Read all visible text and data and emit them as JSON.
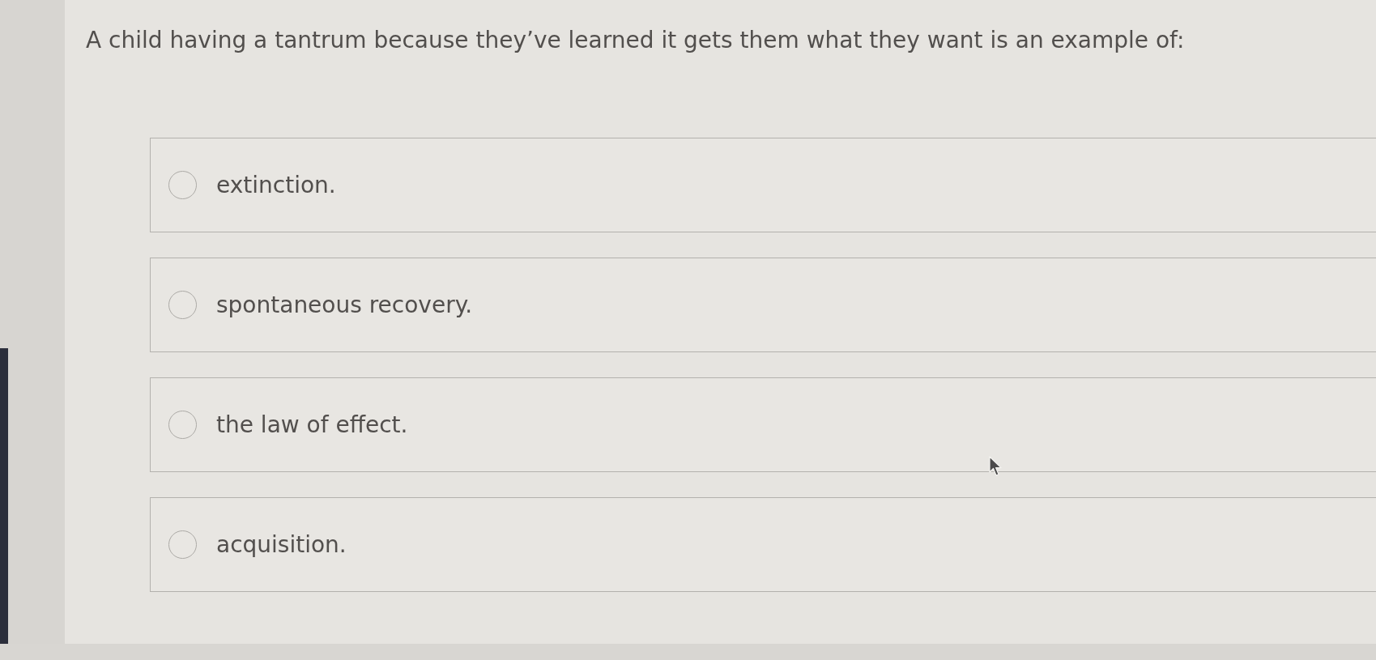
{
  "question": "A child having a tantrum because they’ve learned it gets them what they want is an example of:",
  "options": [
    {
      "label": "extinction.",
      "selected": false
    },
    {
      "label": "spontaneous recovery.",
      "selected": false
    },
    {
      "label": "the law of effect.",
      "selected": false
    },
    {
      "label": "acquisition.",
      "selected": false
    }
  ]
}
